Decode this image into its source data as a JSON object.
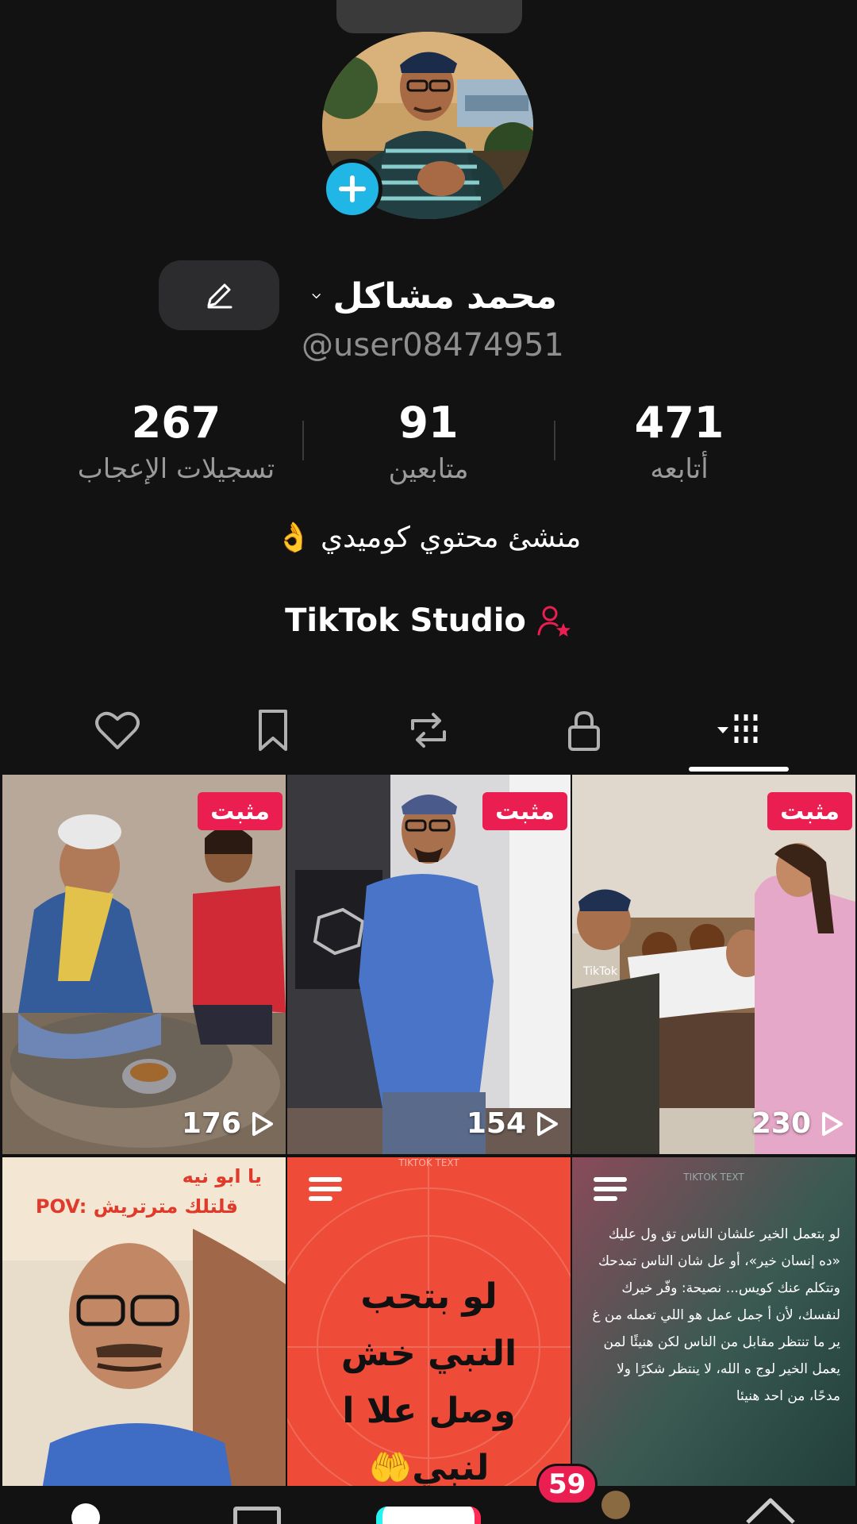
{
  "profile": {
    "display_name": "محمد مشاكل",
    "username": "@user08474951",
    "bio": "منشئ محتوي كوميدي 👌",
    "studio_label": "TikTok Studio"
  },
  "stats": {
    "likes": {
      "value": "267",
      "label": "تسجيلات الإعجاب"
    },
    "followers": {
      "value": "91",
      "label": "متابعين"
    },
    "following": {
      "value": "471",
      "label": "أتابعه"
    }
  },
  "videos": [
    {
      "pinned_label": "مثبت",
      "views": "176"
    },
    {
      "pinned_label": "مثبت",
      "views": "154"
    },
    {
      "pinned_label": "مثبت",
      "views": "230"
    },
    {
      "text_top": "يا ابو نيه",
      "text_pov": "POV: قلتلك مترتريش"
    },
    {
      "text": "لو بتحب النبي خش وصل علا ا لنبي🤲",
      "watermark": "TIKTOK TEXT"
    },
    {
      "watermark": "TIKTOK TEXT",
      "text": "لو بتعمل الخير علشان الناس تق ول عليك «ده إنسان خير»، أو عل شان الناس تمدحك وتتكلم عنك كويس... نصيحة: وفّر خيرك لنفسك، لأن أ جمل عمل هو اللي تعمله من غ ير ما تنتظر مقابل من الناس لكن هنيئًا لمن يعمل الخير لوج ه الله، لا ينتظر شكرًا ولا مدحًا، من احد هنيئا"
    }
  ],
  "nav": {
    "inbox_badge": "59"
  },
  "colors": {
    "accent_red": "#ea1e51",
    "accent_cyan": "#20b6e6",
    "background": "#121212"
  },
  "icons": [
    "add-icon",
    "pencil-icon",
    "chevron-down-icon",
    "creator-star-icon",
    "heart-icon",
    "bookmark-icon",
    "repost-icon",
    "lock-icon",
    "grid-icon",
    "play-icon",
    "menu-lines-icon"
  ]
}
